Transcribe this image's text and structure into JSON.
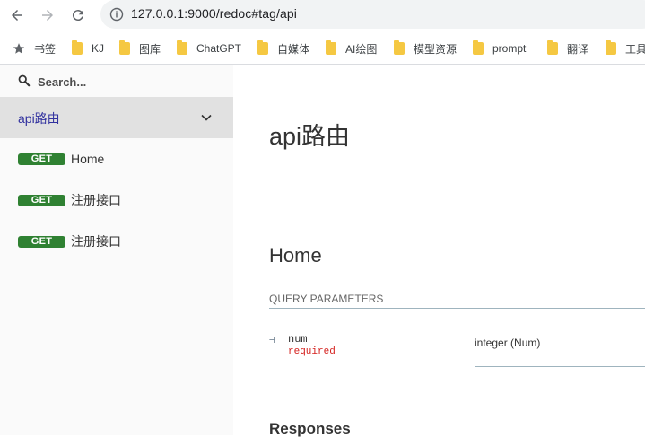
{
  "browser": {
    "url": "127.0.0.1:9000/redoc#tag/api",
    "nav": {
      "back_icon": "arrow-left-icon",
      "forward_icon": "arrow-right-icon",
      "reload_icon": "reload-icon"
    },
    "bookmarks": [
      {
        "label": "书签",
        "icon": "star-icon"
      },
      {
        "label": "KJ",
        "icon": "folder-icon"
      },
      {
        "label": "图库",
        "icon": "folder-icon"
      },
      {
        "label": "ChatGPT",
        "icon": "folder-icon"
      },
      {
        "label": "自媒体",
        "icon": "folder-icon"
      },
      {
        "label": "AI绘图",
        "icon": "folder-icon"
      },
      {
        "label": "模型资源",
        "icon": "folder-icon"
      },
      {
        "label": "prompt",
        "icon": "folder-icon"
      },
      {
        "label": "翻译",
        "icon": "folder-icon"
      },
      {
        "label": "工具",
        "icon": "folder-icon"
      }
    ]
  },
  "sidebar": {
    "search_placeholder": "Search...",
    "tag": {
      "label": "api路由"
    },
    "operations": [
      {
        "method": "GET",
        "label": "Home"
      },
      {
        "method": "GET",
        "label": "注册接口"
      },
      {
        "method": "GET",
        "label": "注册接口"
      }
    ]
  },
  "main": {
    "tag_title": "api路由",
    "operation_title": "Home",
    "query_params_header": "QUERY PARAMETERS",
    "param": {
      "name": "num",
      "required": "required",
      "type": "integer (Num)"
    },
    "responses_title": "Responses"
  },
  "colors": {
    "get_badge": "#2f8132",
    "tag_active_text": "#32329f",
    "required_text": "#d41f1c",
    "sidebar_bg": "#fafafa",
    "active_row_bg": "#e1e1e1"
  }
}
